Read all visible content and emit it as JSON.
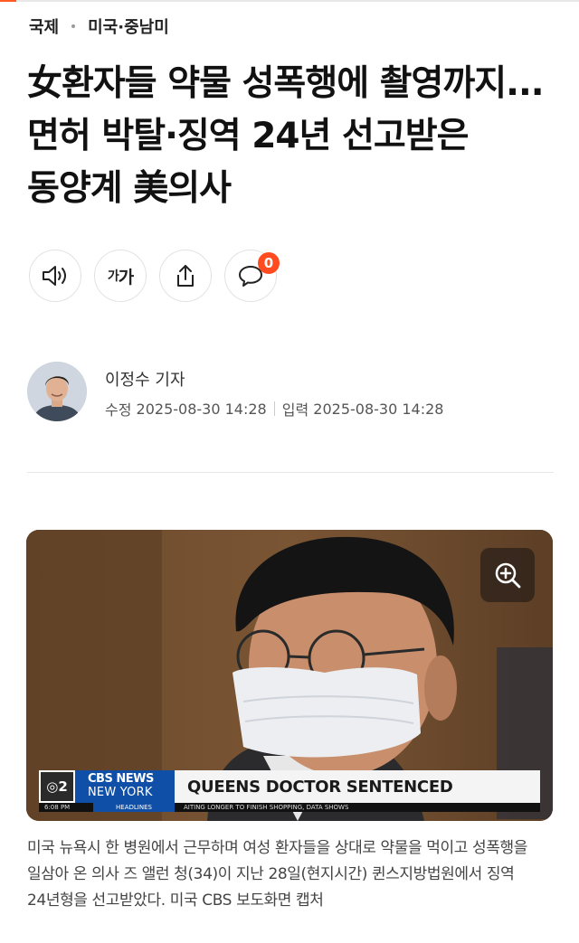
{
  "breadcrumb": {
    "section": "국제",
    "subsection": "미국·중남미"
  },
  "article": {
    "title": "女환자들 약물 성폭행에 촬영까지... 면허 박탈·징역 24년 선고받은 동양계 美의사"
  },
  "toolbar": {
    "listen_icon": "speaker-icon",
    "font_size_label_small": "가",
    "font_size_label_large": "가",
    "share_icon": "share-icon",
    "comment_icon": "comment-icon",
    "comment_count": "0"
  },
  "byline": {
    "author": "이정수 기자",
    "modified_label": "수정",
    "modified_datetime": "2025-08-30 14:28",
    "published_label": "입력",
    "published_datetime": "2025-08-30 14:28"
  },
  "photo": {
    "zoom_icon": "zoom-in-icon",
    "channel_badge": "2",
    "network_line1": "CBS NEWS",
    "network_line2": "NEW YORK",
    "headline": "QUEENS DOCTOR SENTENCED",
    "time": "6:08 PM",
    "strip_label": "HEADLINES",
    "crawl": "AITING LONGER TO FINISH SHOPPING, DATA SHOWS"
  },
  "caption": "미국 뉴욕시 한 병원에서 근무하며 여성 환자들을 상대로 약물을 먹이고 성폭행을 일삼아 온 의사 즈 앨런 청(34)이 지난 28일(현지시간) 퀸스지방법원에서 징역 24년형을 선고받았다. 미국 CBS 보도화면 캡처",
  "colors": {
    "accent": "#ff4b1f",
    "cbs_blue": "#0f4fa8"
  }
}
